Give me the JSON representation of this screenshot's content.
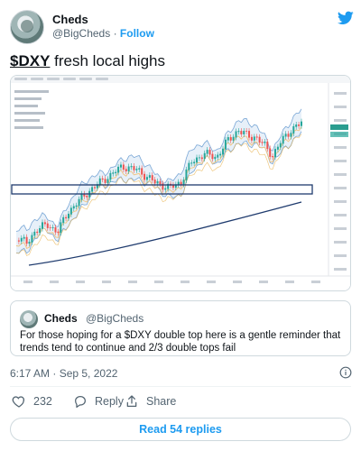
{
  "author": {
    "name": "Cheds",
    "handle": "@BigCheds",
    "follow_label": "Follow",
    "separator": "·"
  },
  "tweet": {
    "cashtag": "$DXY",
    "text": " fresh local highs"
  },
  "chart_image": {
    "description_icon": "tradingview-chart",
    "accent_colors": {
      "up_candle": "#26a69a",
      "down_candle": "#ef5350",
      "bollinger_band": "#7aa7d6",
      "moving_average": "#f3c37c",
      "long_ma": "#1f3b6e",
      "box_outline": "#1f3b6e"
    }
  },
  "quote": {
    "name": "Cheds",
    "handle": "@BigCheds",
    "text": "For those hoping for a $DXY double top here is a gentle reminder that trends tend to continue and 2/3 double tops fail"
  },
  "timestamp": "6:17 AM · Sep 5, 2022",
  "actions": {
    "like_count": "232",
    "reply_label": "Reply",
    "share_label": "Share"
  },
  "read_replies_label": "Read 54 replies",
  "colors": {
    "brand": "#1d9bf0",
    "text_primary": "#0f1419",
    "text_secondary": "#536471",
    "border": "#cfd9de"
  }
}
